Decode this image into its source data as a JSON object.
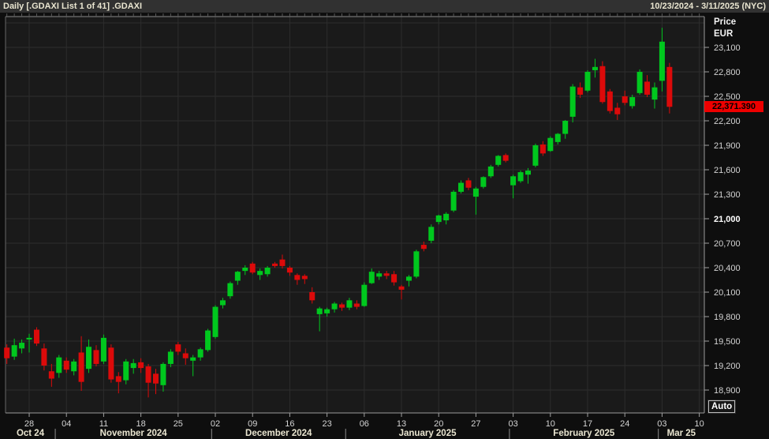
{
  "header": {
    "title": "Daily [.GDAXI List 1 of 41] .GDAXI",
    "date_range": "10/23/2024 - 3/11/2025 (NYC)"
  },
  "price_axis": {
    "title_line1": "Price",
    "title_line2": "EUR",
    "last_price": "22,371.390",
    "ticks": [
      {
        "v": 23100,
        "t": "23,100"
      },
      {
        "v": 22800,
        "t": "22,800"
      },
      {
        "v": 22500,
        "t": "22,500"
      },
      {
        "v": 22200,
        "t": "22,200"
      },
      {
        "v": 21900,
        "t": "21,900"
      },
      {
        "v": 21600,
        "t": "21,600"
      },
      {
        "v": 21300,
        "t": "21,300"
      },
      {
        "v": 21000,
        "t": "21,000",
        "bold": true
      },
      {
        "v": 20700,
        "t": "20,700"
      },
      {
        "v": 20400,
        "t": "20,400"
      },
      {
        "v": 20100,
        "t": "20,100"
      },
      {
        "v": 19800,
        "t": "19,800"
      },
      {
        "v": 19500,
        "t": "19,500"
      },
      {
        "v": 19200,
        "t": "19,200"
      },
      {
        "v": 18900,
        "t": "18,900"
      }
    ]
  },
  "time_axis": {
    "week_ticks": [
      {
        "i": 3,
        "t": "28"
      },
      {
        "i": 8,
        "t": "04"
      },
      {
        "i": 13,
        "t": "11"
      },
      {
        "i": 18,
        "t": "18"
      },
      {
        "i": 23,
        "t": "25"
      },
      {
        "i": 28,
        "t": "02"
      },
      {
        "i": 33,
        "t": "09"
      },
      {
        "i": 38,
        "t": "16"
      },
      {
        "i": 43,
        "t": "23"
      },
      {
        "i": 48,
        "t": "06"
      },
      {
        "i": 53,
        "t": "13"
      },
      {
        "i": 58,
        "t": "20"
      },
      {
        "i": 63,
        "t": "27"
      },
      {
        "i": 68,
        "t": "03"
      },
      {
        "i": 73,
        "t": "10"
      },
      {
        "i": 78,
        "t": "17"
      },
      {
        "i": 83,
        "t": "24"
      },
      {
        "i": 88,
        "t": "03"
      },
      {
        "i": 93,
        "t": "10"
      }
    ],
    "months": [
      {
        "label": "Oct 24",
        "start": 0,
        "end": 6
      },
      {
        "label": "November 2024",
        "start": 7,
        "end": 27
      },
      {
        "label": "December 2024",
        "start": 28,
        "end": 45
      },
      {
        "label": "January 2025",
        "start": 46,
        "end": 67
      },
      {
        "label": "February 2025",
        "start": 68,
        "end": 87
      },
      {
        "label": "Mar 25",
        "start": 88,
        "end": 93
      }
    ]
  },
  "auto_button": {
    "label": "Auto"
  },
  "colors": {
    "up": "#00c81e",
    "down": "#dc0a0a",
    "last_price_bg": "#ee0000",
    "plot_bg": "#1a1a1a",
    "grid": "#2d2d2d",
    "border": "#8a8a8a",
    "tick": "#a0a0a0",
    "label": "#d4d4d4",
    "month_label": "#e9e5d0"
  },
  "chart_data": {
    "type": "candlestick",
    "title": "Daily [.GDAXI List 1 of 41] .GDAXI",
    "symbol": ".GDAXI",
    "interval": "Daily",
    "currency": "EUR",
    "period": "10/23/2024 - 3/11/2025 (NYC)",
    "last_price": 22371.39,
    "y_range": [
      18600,
      23400
    ],
    "grid_step": 300,
    "legend_position": "none",
    "grid": true,
    "ohlc_columns": [
      "date",
      "open",
      "high",
      "low",
      "close"
    ],
    "ohlc": [
      [
        "10/23",
        19420,
        19460,
        19220,
        19290
      ],
      [
        "10/24",
        19310,
        19530,
        19270,
        19450
      ],
      [
        "10/25",
        19410,
        19520,
        19350,
        19480
      ],
      [
        "10/28",
        19520,
        19590,
        19360,
        19540
      ],
      [
        "10/29",
        19640,
        19670,
        19440,
        19470
      ],
      [
        "10/30",
        19410,
        19470,
        19140,
        19200
      ],
      [
        "10/31",
        19130,
        19220,
        18940,
        19040
      ],
      [
        "11/01",
        19110,
        19330,
        19050,
        19300
      ],
      [
        "11/04",
        19260,
        19300,
        19110,
        19150
      ],
      [
        "11/05",
        19130,
        19280,
        19080,
        19250
      ],
      [
        "11/06",
        19360,
        19560,
        18890,
        19000
      ],
      [
        "11/07",
        19160,
        19520,
        19110,
        19430
      ],
      [
        "11/08",
        19390,
        19450,
        19190,
        19220
      ],
      [
        "11/11",
        19250,
        19580,
        19220,
        19540
      ],
      [
        "11/12",
        19420,
        19460,
        18990,
        19030
      ],
      [
        "11/13",
        19070,
        19120,
        18860,
        19000
      ],
      [
        "11/14",
        19020,
        19280,
        18970,
        19250
      ],
      [
        "11/15",
        19170,
        19280,
        19100,
        19230
      ],
      [
        "11/18",
        19240,
        19290,
        19110,
        19170
      ],
      [
        "11/19",
        19190,
        19220,
        18810,
        18990
      ],
      [
        "11/20",
        19100,
        19160,
        18850,
        18980
      ],
      [
        "11/21",
        18960,
        19240,
        18880,
        19220
      ],
      [
        "11/22",
        19220,
        19400,
        19180,
        19370
      ],
      [
        "11/25",
        19460,
        19490,
        19330,
        19370
      ],
      [
        "11/26",
        19350,
        19410,
        19210,
        19290
      ],
      [
        "11/27",
        19260,
        19330,
        19070,
        19300
      ],
      [
        "11/28",
        19300,
        19420,
        19260,
        19400
      ],
      [
        "11/29",
        19390,
        19650,
        19370,
        19630
      ],
      [
        "12/02",
        19550,
        19940,
        19530,
        19920
      ],
      [
        "12/03",
        19940,
        20030,
        19900,
        20000
      ],
      [
        "12/04",
        20050,
        20230,
        20020,
        20210
      ],
      [
        "12/05",
        20240,
        20360,
        20190,
        20350
      ],
      [
        "12/06",
        20360,
        20430,
        20310,
        20400
      ],
      [
        "12/09",
        20450,
        20470,
        20320,
        20340
      ],
      [
        "12/10",
        20310,
        20390,
        20250,
        20360
      ],
      [
        "12/11",
        20320,
        20420,
        20290,
        20400
      ],
      [
        "12/12",
        20450,
        20470,
        20400,
        20420
      ],
      [
        "12/13",
        20500,
        20560,
        20390,
        20420
      ],
      [
        "12/16",
        20400,
        20420,
        20300,
        20340
      ],
      [
        "12/17",
        20310,
        20330,
        20190,
        20250
      ],
      [
        "12/18",
        20300,
        20320,
        20200,
        20260
      ],
      [
        "12/19",
        20100,
        20160,
        19960,
        20000
      ],
      [
        "12/20",
        19830,
        19920,
        19620,
        19900
      ],
      [
        "12/23",
        19840,
        19910,
        19800,
        19890
      ],
      [
        "12/27",
        19890,
        19980,
        19850,
        19960
      ],
      [
        "12/30",
        19950,
        19970,
        19870,
        19910
      ],
      [
        "01/02",
        19910,
        20030,
        19880,
        20000
      ],
      [
        "01/03",
        19960,
        20000,
        19890,
        19920
      ],
      [
        "01/06",
        19930,
        20220,
        19920,
        20190
      ],
      [
        "01/07",
        20210,
        20390,
        20200,
        20350
      ],
      [
        "01/08",
        20290,
        20360,
        20250,
        20330
      ],
      [
        "01/09",
        20330,
        20360,
        20260,
        20300
      ],
      [
        "01/10",
        20320,
        20360,
        20180,
        20220
      ],
      [
        "01/13",
        20170,
        20190,
        20010,
        20130
      ],
      [
        "01/14",
        20240,
        20310,
        20170,
        20290
      ],
      [
        "01/15",
        20290,
        20620,
        20270,
        20600
      ],
      [
        "01/16",
        20680,
        20720,
        20600,
        20630
      ],
      [
        "01/17",
        20730,
        20930,
        20700,
        20900
      ],
      [
        "01/20",
        20960,
        21050,
        20930,
        21040
      ],
      [
        "01/21",
        20980,
        21080,
        20930,
        21060
      ],
      [
        "01/22",
        21100,
        21350,
        21080,
        21330
      ],
      [
        "01/23",
        21330,
        21470,
        21310,
        21440
      ],
      [
        "01/24",
        21470,
        21500,
        21350,
        21380
      ],
      [
        "01/27",
        21270,
        21390,
        21050,
        21370
      ],
      [
        "01/28",
        21390,
        21520,
        21370,
        21510
      ],
      [
        "01/29",
        21520,
        21660,
        21500,
        21640
      ],
      [
        "01/30",
        21660,
        21780,
        21640,
        21770
      ],
      [
        "01/31",
        21780,
        21800,
        21690,
        21710
      ],
      [
        "02/03",
        21410,
        21540,
        21250,
        21520
      ],
      [
        "02/04",
        21460,
        21590,
        21440,
        21570
      ],
      [
        "02/05",
        21540,
        21620,
        21430,
        21590
      ],
      [
        "02/06",
        21650,
        21920,
        21630,
        21900
      ],
      [
        "02/07",
        21910,
        21950,
        21770,
        21800
      ],
      [
        "02/10",
        21830,
        22010,
        21820,
        21990
      ],
      [
        "02/11",
        21940,
        22050,
        21910,
        22040
      ],
      [
        "02/12",
        22040,
        22210,
        21980,
        22200
      ],
      [
        "02/13",
        22250,
        22650,
        22180,
        22620
      ],
      [
        "02/14",
        22610,
        22670,
        22480,
        22520
      ],
      [
        "02/17",
        22570,
        22820,
        22550,
        22800
      ],
      [
        "02/18",
        22820,
        22960,
        22730,
        22860
      ],
      [
        "02/19",
        22870,
        22930,
        22410,
        22430
      ],
      [
        "02/20",
        22560,
        22590,
        22290,
        22320
      ],
      [
        "02/21",
        22360,
        22420,
        22210,
        22280
      ],
      [
        "02/24",
        22500,
        22570,
        22390,
        22420
      ],
      [
        "02/25",
        22380,
        22520,
        22350,
        22490
      ],
      [
        "02/26",
        22540,
        22830,
        22520,
        22800
      ],
      [
        "02/27",
        22680,
        22760,
        22490,
        22520
      ],
      [
        "02/28",
        22460,
        22670,
        22350,
        22610
      ],
      [
        "03/03",
        22690,
        23340,
        22560,
        23170
      ],
      [
        "03/04",
        22860,
        22910,
        22290,
        22371.39
      ]
    ]
  }
}
